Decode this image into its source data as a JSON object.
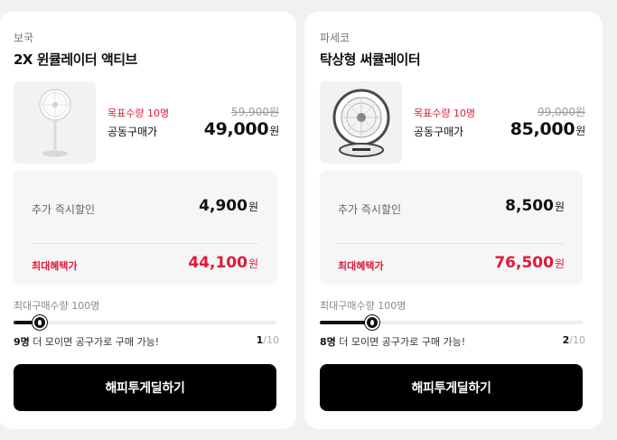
{
  "products": [
    {
      "brand": "보국",
      "title": "2X 윈큘레이터 액티브",
      "image_icon": "standing-fan-icon",
      "goal": "목표수량 10명",
      "group_price_label": "공동구매가",
      "original_price": "59,900원",
      "price": "49,000",
      "price_unit": "원",
      "extra_discount_label": "추가 즉시할인",
      "extra_discount": "4,900",
      "extra_discount_unit": "원",
      "max_benefit_label": "최대혜택가",
      "max_benefit": "44,100",
      "max_benefit_unit": "원",
      "max_buyers": "최대구매수량 100명",
      "progress_fraction": 0.1,
      "status_count": "9명",
      "status_text": " 더 모이면 공구가로 구매 가능!",
      "page_current": "1",
      "page_total": "/10",
      "cta": "해피투게딜하기"
    },
    {
      "brand": "파세코",
      "title": "탁상형 써큘레이터",
      "image_icon": "desk-circulator-icon",
      "goal": "목표수량 10명",
      "group_price_label": "공동구매가",
      "original_price": "99,000원",
      "price": "85,000",
      "price_unit": "원",
      "extra_discount_label": "추가 즉시할인",
      "extra_discount": "8,500",
      "extra_discount_unit": "원",
      "max_benefit_label": "최대혜택가",
      "max_benefit": "76,500",
      "max_benefit_unit": "원",
      "max_buyers": "최대구매수량 100명",
      "progress_fraction": 0.2,
      "status_count": "8명",
      "status_text": " 더 모이면 공구가로 구매 가능!",
      "page_current": "2",
      "page_total": "/10",
      "cta": "해피투게딜하기"
    }
  ],
  "colors": {
    "accent": "#e0193a",
    "button": "#000000",
    "card": "#ffffff",
    "panel": "#f6f6f6"
  }
}
